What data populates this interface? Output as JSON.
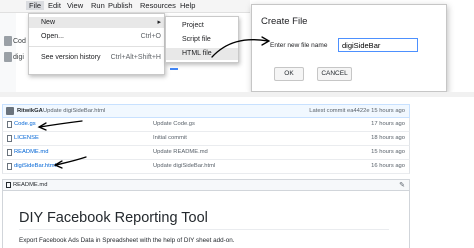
{
  "menubar": {
    "items": [
      "File",
      "Edit",
      "View",
      "Run",
      "Publish",
      "Resources",
      "Help"
    ]
  },
  "behind": {
    "code_label": "Cod",
    "digi_label": "digi"
  },
  "file_menu": {
    "new": "New",
    "new_arrow": "▸",
    "open": "Open...",
    "open_shortcut": "Ctrl+O",
    "version_history": "See version history",
    "version_shortcut": "Ctrl+Alt+Shift+H"
  },
  "new_submenu": {
    "items": [
      "Project",
      "Script file",
      "HTML file"
    ]
  },
  "create_file_dialog": {
    "title": "Create File",
    "label": "Enter new file name",
    "value": "digiSideBar",
    "ok": "OK",
    "cancel": "CANCEL"
  },
  "commit_bar": {
    "user": "RitwikGA",
    "message": "Update digiSideBar.html",
    "latest": "Latest commit ea4422e 15 hours ago"
  },
  "files": [
    {
      "name": "Code.gs",
      "message": "Update Code.gs",
      "age": "17 hours ago"
    },
    {
      "name": "LICENSE",
      "message": "Initial commit",
      "age": "18 hours ago"
    },
    {
      "name": "README.md",
      "message": "Update README.md",
      "age": "15 hours ago"
    },
    {
      "name": "digiSideBar.html",
      "message": "Update digiSideBar.html",
      "age": "16 hours ago"
    }
  ],
  "readme": {
    "filename": "README.md",
    "title": "DIY Facebook Reporting Tool",
    "text": "Export Facebook Ads Data in Spreadsheet with the help of DIY sheet add-on."
  },
  "colors": {
    "link_blue": "#0366d6",
    "focus_blue": "#4d90fe",
    "annotation_black": "#000000"
  }
}
